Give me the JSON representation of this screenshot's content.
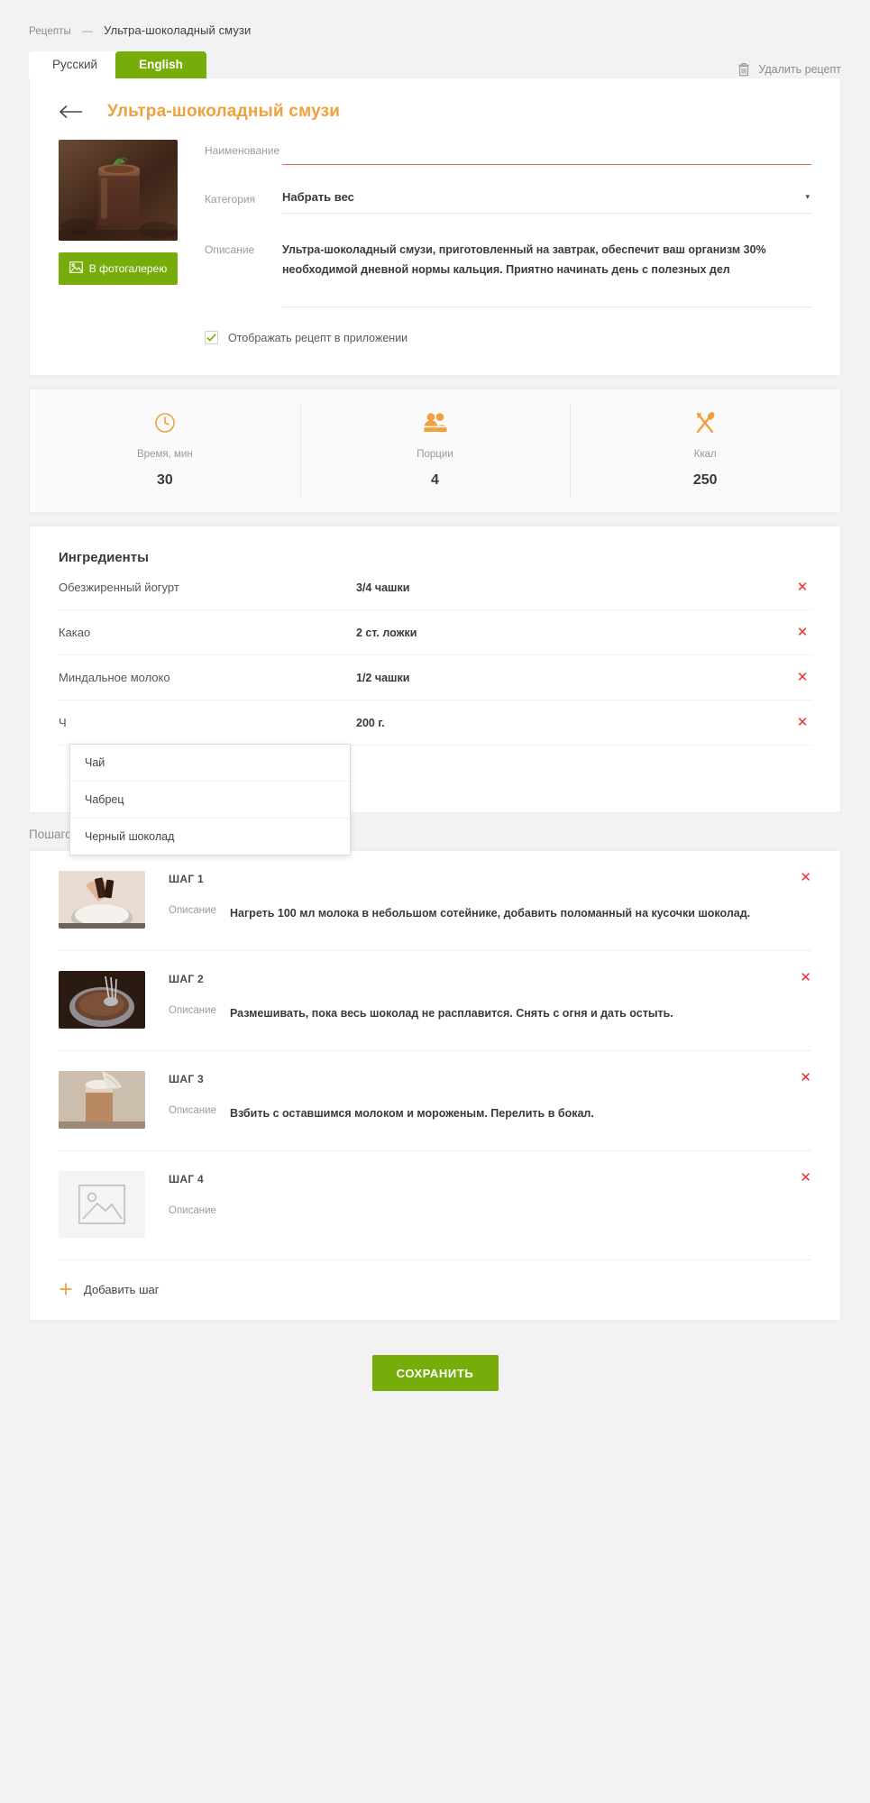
{
  "breadcrumb": {
    "root": "Рецепты",
    "separator": "—",
    "current": "Ультра-шоколадный смузи"
  },
  "tabs": [
    {
      "label": "Русский",
      "active": false
    },
    {
      "label": "English",
      "active": true
    }
  ],
  "delete_recipe": {
    "label": "Удалить рецепт",
    "icon": "trash-icon"
  },
  "header": {
    "title": "Ультра-шоколадный смузи",
    "back_icon": "arrow-left-icon"
  },
  "form": {
    "gallery_button": {
      "label": "В фотогалерею",
      "icon": "image-icon",
      "color": "#76ad0a"
    },
    "name": {
      "label": "Наименование",
      "value": "",
      "error": true,
      "error_color": "#e0615b"
    },
    "category": {
      "label": "Категория",
      "value": "Набрать вес",
      "caret": "▾"
    },
    "description": {
      "label": "Описание",
      "value": "Ультра-шоколадный смузи, приготовленный на завтрак, обеспечит ваш организм 30% необходимой дневной нормы кальция. Приятно начинать день с полезных дел"
    },
    "show_in_app": {
      "label": "Отображать рецепт в приложении",
      "checked": true
    }
  },
  "stats": [
    {
      "icon": "clock-icon",
      "label": "Время, мин",
      "value": "30"
    },
    {
      "icon": "people-icon",
      "label": "Порции",
      "value": "4"
    },
    {
      "icon": "cutlery-icon",
      "label": "Ккал",
      "value": "250"
    }
  ],
  "ingredients": {
    "title": "Ингредиенты",
    "rows": [
      {
        "name": "Обезжиренный йогурт",
        "qty": "3/4 чашки",
        "delete": "✕"
      },
      {
        "name": "Какао",
        "qty": "2 ст. ложки",
        "delete": "✕"
      },
      {
        "name": "Миндальное молоко",
        "qty": "1/2 чашки",
        "delete": "✕"
      },
      {
        "name": "Ч",
        "qty": "200 г.",
        "delete": "✕"
      }
    ],
    "autocomplete": [
      "Чай",
      "Чабрец",
      "Черный шоколад"
    ]
  },
  "steps": {
    "heading": "Пошаговый рецепт приготовления",
    "desc_label": "Описание",
    "items": [
      {
        "title": "ШАГ 1",
        "description": "Нагреть 100 мл молока в небольшом сотейнике, добавить поломанный на кусочки шоколад.",
        "has_photo": true,
        "delete": "✕"
      },
      {
        "title": "ШАГ 2",
        "description": "Размешивать, пока весь шоколад не расплавится. Снять с огня и дать остыть.",
        "has_photo": true,
        "delete": "✕"
      },
      {
        "title": "ШАГ 3",
        "description": "Взбить с оставшимся молоком и мороженым. Перелить в бокал.",
        "has_photo": true,
        "delete": "✕"
      },
      {
        "title": "ШАГ 4",
        "description": "",
        "has_photo": false,
        "delete": "✕"
      }
    ],
    "add_step": {
      "label": "Добавить шаг",
      "icon": "plus-icon"
    }
  },
  "save_button": {
    "label": "СОХРАНИТЬ",
    "color": "#76ad0a"
  },
  "accent": {
    "orange": "#f0a03c",
    "green": "#76ad0a",
    "red": "#e8322a"
  }
}
